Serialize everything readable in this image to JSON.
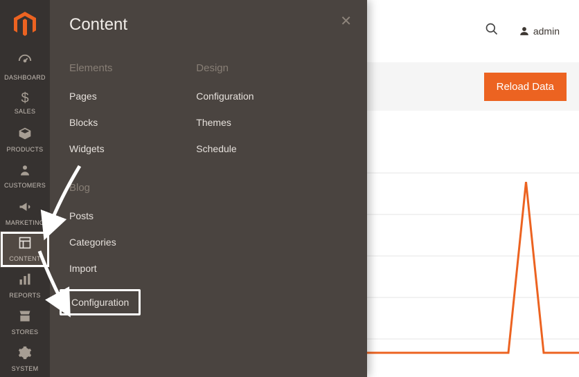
{
  "rail": {
    "items": [
      {
        "label": "DASHBOARD",
        "icon": "gauge"
      },
      {
        "label": "SALES",
        "icon": "dollar"
      },
      {
        "label": "PRODUCTS",
        "icon": "cube"
      },
      {
        "label": "CUSTOMERS",
        "icon": "person"
      },
      {
        "label": "MARKETING",
        "icon": "bullhorn"
      },
      {
        "label": "CONTENT",
        "icon": "layout"
      },
      {
        "label": "REPORTS",
        "icon": "bars"
      },
      {
        "label": "STORES",
        "icon": "storefront"
      },
      {
        "label": "SYSTEM",
        "icon": "gears"
      }
    ]
  },
  "flyout": {
    "title": "Content",
    "sections": {
      "elements": {
        "heading": "Elements",
        "items": [
          "Pages",
          "Blocks",
          "Widgets"
        ]
      },
      "design": {
        "heading": "Design",
        "items": [
          "Configuration",
          "Themes",
          "Schedule"
        ]
      },
      "blog": {
        "heading": "Blog",
        "items": [
          "Posts",
          "Categories",
          "Import",
          "Configuration"
        ]
      }
    }
  },
  "header": {
    "admin_label": "admin"
  },
  "page": {
    "reload_label": "Reload Data"
  },
  "chart_data": {
    "type": "line",
    "title": "",
    "xlabel": "",
    "ylabel": "",
    "x": [
      0,
      1,
      2,
      3,
      4,
      5,
      6,
      7,
      8,
      9,
      10,
      11,
      12
    ],
    "values": [
      0,
      0,
      0,
      0,
      0,
      0,
      0,
      0,
      0,
      95,
      0,
      0,
      0
    ],
    "ylim": [
      0,
      100
    ],
    "color": "#ec6321"
  }
}
